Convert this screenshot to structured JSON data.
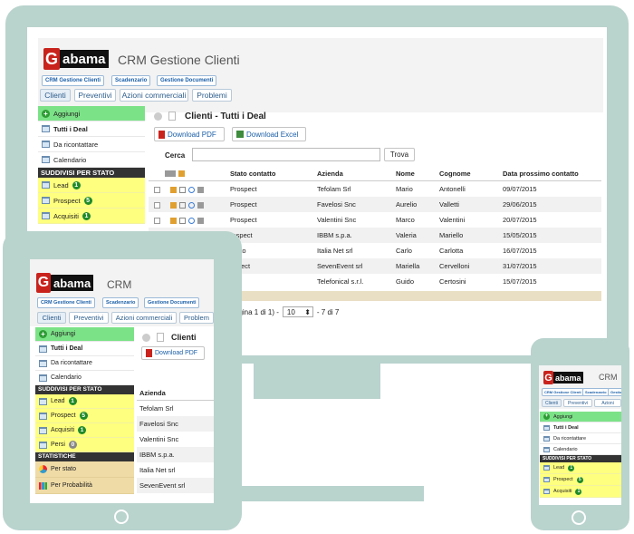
{
  "app": {
    "logo_g": "G",
    "logo_text": "abama",
    "title": "CRM Gestione Clienti",
    "title_short": "CRM"
  },
  "topbar": {
    "crm": "CRM Gestione Clienti",
    "scad": "Scadenzario",
    "doc": "Gestione Documenti",
    "doc_short": "Gestione Documenti",
    "doc_tiny": "Gestione"
  },
  "tabs": [
    "Clienti",
    "Preventivi",
    "Azioni commerciali",
    "Problemi"
  ],
  "tabs_tablet": [
    "Clienti",
    "Preventivi",
    "Azioni commerciali",
    "Problem"
  ],
  "tabs_phone": [
    "Clienti",
    "Preventivi",
    "Azioni"
  ],
  "sidebar": {
    "add": "Aggiungi",
    "all": "Tutti i Deal",
    "callback": "Da ricontattare",
    "calendar": "Calendario",
    "state_header": "SUDDIVISI PER STATO",
    "states": [
      {
        "label": "Lead",
        "count": "1"
      },
      {
        "label": "Prospect",
        "count": "5"
      },
      {
        "label": "Acquisiti",
        "count": "1"
      },
      {
        "label": "Persi",
        "count": "0"
      }
    ],
    "stats_header": "STATISTICHE",
    "stat1": "Per stato",
    "stat2": "Per Probabilità"
  },
  "main": {
    "heading": "Clienti - Tutti i Deal",
    "heading_short": "Clienti",
    "pdf": "Download PDF",
    "excel": "Download Excel",
    "search_label": "Cerca",
    "search_value": "",
    "search_btn": "Trova",
    "columns": [
      "Stato contatto",
      "Azienda",
      "Nome",
      "Cognome",
      "Data prossimo contatto"
    ],
    "rows": [
      [
        "Prospect",
        "Tefolam Srl",
        "Mario",
        "Antonelli",
        "09/07/2015"
      ],
      [
        "Prospect",
        "Favelosi Snc",
        "Aurelio",
        "Valletti",
        "29/06/2015"
      ],
      [
        "Prospect",
        "Valentini Snc",
        "Marco",
        "Valentini",
        "20/07/2015"
      ],
      [
        "rospect",
        "IBBM s.p.a.",
        "Valeria",
        "Mariello",
        "15/05/2015"
      ],
      [
        "uisito",
        "Italia Net srl",
        "Carlo",
        "Carlotta",
        "16/07/2015"
      ],
      [
        "ospect",
        "SevenEvent srl",
        "Mariella",
        "Cervelloni",
        "31/07/2015"
      ],
      [
        "ad",
        "Telefonical s.r.l.",
        "Guido",
        "Certosini",
        "15/07/2015"
      ]
    ],
    "pagination": "agina 1 di 1) -",
    "page_size": "10",
    "page_range": "- 7 di 7"
  },
  "tablet": {
    "col": "Azienda",
    "rows": [
      "Tefolam Srl",
      "Favelosi Snc",
      "Valentini Snc",
      "IBBM s.p.a.",
      "Italia Net srl",
      "SevenEvent srl"
    ]
  },
  "colors": {
    "device": "#b9d3cd",
    "green": "#7ce287",
    "yellow": "#ffff7f",
    "beige": "#efdba6",
    "header": "#333333",
    "brand_red": "#c9231d"
  }
}
